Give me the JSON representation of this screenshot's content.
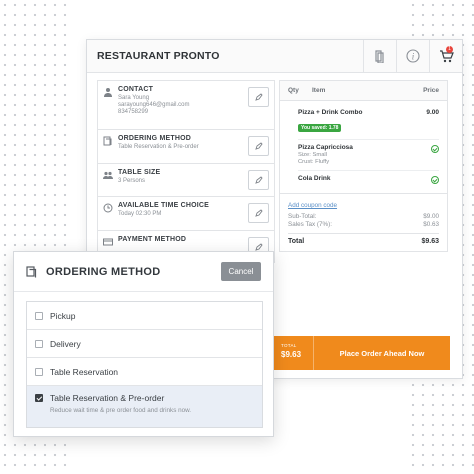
{
  "app": {
    "title": "RESTAURANT PRONTO",
    "cart_count": "1"
  },
  "steps": [
    {
      "title": "CONTACT",
      "lines": [
        "Sara Young",
        "sarayoung646@gmail.com",
        "834758299"
      ]
    },
    {
      "title": "ORDERING METHOD",
      "lines": [
        "Table Reservation & Pre-order"
      ]
    },
    {
      "title": "TABLE SIZE",
      "lines": [
        "3 Persons"
      ]
    },
    {
      "title": "AVAILABLE TIME CHOICE",
      "lines": [
        "Today 02:30 PM"
      ]
    },
    {
      "title": "PAYMENT METHOD",
      "lines": []
    }
  ],
  "order": {
    "headers": {
      "qty": "Qty",
      "item": "Item",
      "price": "Price"
    },
    "items": [
      {
        "name": "Pizza + Drink Combo",
        "price": "9.00",
        "saved": "You saved: 1.78"
      },
      {
        "name": "Pizza Capricciosa",
        "details": [
          "Size: Small",
          "Crust: Fluffy"
        ]
      },
      {
        "name": "Cola Drink"
      }
    ],
    "coupon_link": "Add coupon code",
    "subtotal_label": "Sub-Total:",
    "subtotal": "$9.00",
    "tax_label": "Sales Tax (7%):",
    "tax": "$0.63",
    "total_label": "Total",
    "total": "$9.63"
  },
  "footer": {
    "total_label": "TOTAL",
    "total": "$9.63",
    "button": "Place Order Ahead Now"
  },
  "modal": {
    "title": "ORDERING METHOD",
    "cancel": "Cancel",
    "options": [
      {
        "label": "Pickup",
        "checked": false
      },
      {
        "label": "Delivery",
        "checked": false
      },
      {
        "label": "Table Reservation",
        "checked": false
      },
      {
        "label": "Table Reservation & Pre-order",
        "checked": true,
        "description": "Reduce wait time & pre order food and drinks now."
      }
    ]
  },
  "colors": {
    "accent": "#f08a1c",
    "success": "#3aa641",
    "selected_bg": "#e9eef6"
  },
  "icons": [
    "book-icon",
    "info-icon",
    "cart-icon",
    "person-icon",
    "menu-book-icon",
    "group-icon",
    "clock-icon",
    "credit-card-icon",
    "pencil-icon"
  ]
}
